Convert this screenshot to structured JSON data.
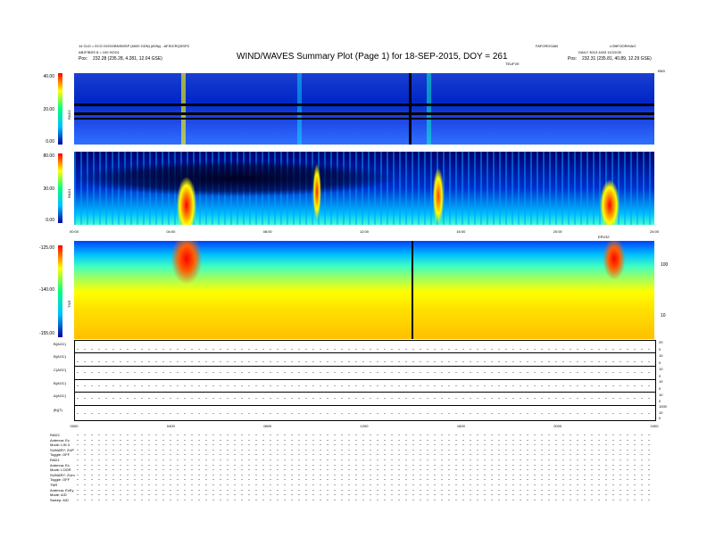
{
  "header": {
    "left_line1": "14 GLD = ECG DGSGBNSWSP (6000 GDN) (609y) - AFIDCRQSSPC",
    "left_line2": "ABJFIBSS 8 = 100 HOG1",
    "left_pos_label": "Pos:",
    "left_pos_value": "232.28 (235.28, 4.281, 12.04 GSE)",
    "title": "WIND/WAVES Summary Plot (Page 1) for 18-SEP-2015, DOY = 261",
    "right_top1": "FAFORGOAB",
    "right_top2": "LOBFOORHIAO",
    "right_line2": "DAILY 3013 4403 11CDCB",
    "right_pos_label": "Pos:",
    "right_pos_value": "232.31 (235.81, 40.89, 12.29 GSE)",
    "ticks_label_top": "TEUFVE",
    "top_right_mark": "BN3"
  },
  "rad2": {
    "label": "RAD2",
    "ticks": [
      "40.00",
      "20.00",
      "0.00"
    ]
  },
  "rad1": {
    "label": "RAD1",
    "ticks": [
      "80.00",
      "30.00",
      "0.00"
    ]
  },
  "time_axis": {
    "ticks": [
      "00:00",
      "04:00",
      "08:00",
      "12:00",
      "16:00",
      "20:00",
      "24:00"
    ]
  },
  "tnr": {
    "label": "TNR",
    "ticks": [
      "-125.00",
      "-140.00",
      "-155.00"
    ],
    "right_ticks": [
      "100",
      "10"
    ],
    "right_mark": "ERV32"
  },
  "strips": {
    "labels": [
      "B(AGC)",
      "B(AGC)",
      "C(AGC)",
      "B(AGC)",
      "A(AGC)",
      "|B|(T)"
    ],
    "right_ticks": [
      [
        "20",
        "0"
      ],
      [
        "10",
        "0"
      ],
      [
        "10",
        "0"
      ],
      [
        "10",
        "0"
      ],
      [
        "10",
        "0"
      ],
      [
        "1000",
        "10",
        "0"
      ]
    ]
  },
  "bottom_axis": {
    "ticks": [
      "0000",
      "0400",
      "0800",
      "1200",
      "1600",
      "2000",
      "2400"
    ]
  },
  "status_rows": [
    "RAD2",
    "Antenna:   Ex",
    "Mode:   LIN 3",
    "SUMARY:   ZUP",
    "Toggle:   OFF",
    "RAD1",
    "Antenna:   Ex",
    "Mode:   LOGR",
    "SUMARY:   ZUm",
    "Toggle:   OFF",
    "TNR",
    "Antenna:   ExEy",
    "Mode:   A/D",
    "Sweep:   A/D"
  ],
  "colors": {
    "spectrum_low": "#00008f",
    "spectrum_mid": "#00ffff",
    "spectrum_high": "#ff0000",
    "tnr_base": "#ffff00"
  }
}
